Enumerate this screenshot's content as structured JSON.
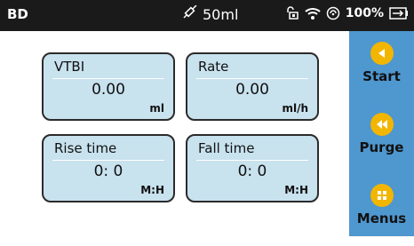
{
  "status": {
    "brand": "BD",
    "volume": "50ml",
    "battery": "100%"
  },
  "params": [
    {
      "label": "VTBI",
      "value": "0.00",
      "unit": "ml"
    },
    {
      "label": "Rate",
      "value": "0.00",
      "unit": "ml/h"
    },
    {
      "label": "Rise time",
      "value": "0: 0",
      "unit": "M:H"
    },
    {
      "label": "Fall time",
      "value": "0: 0",
      "unit": "M:H"
    }
  ],
  "side": {
    "start": "Start",
    "purge": "Purge",
    "menus": "Menus"
  },
  "colors": {
    "status_bg": "#1a1a1a",
    "card_bg": "#c8e2ee",
    "side_bg": "#4f97cf",
    "button_accent": "#f2b600"
  },
  "icons": [
    "syringe-icon",
    "lock-icon",
    "wifi-icon",
    "signal-icon",
    "battery-charging-icon",
    "play-back-icon",
    "rewind-icon",
    "menu-grid-icon"
  ]
}
